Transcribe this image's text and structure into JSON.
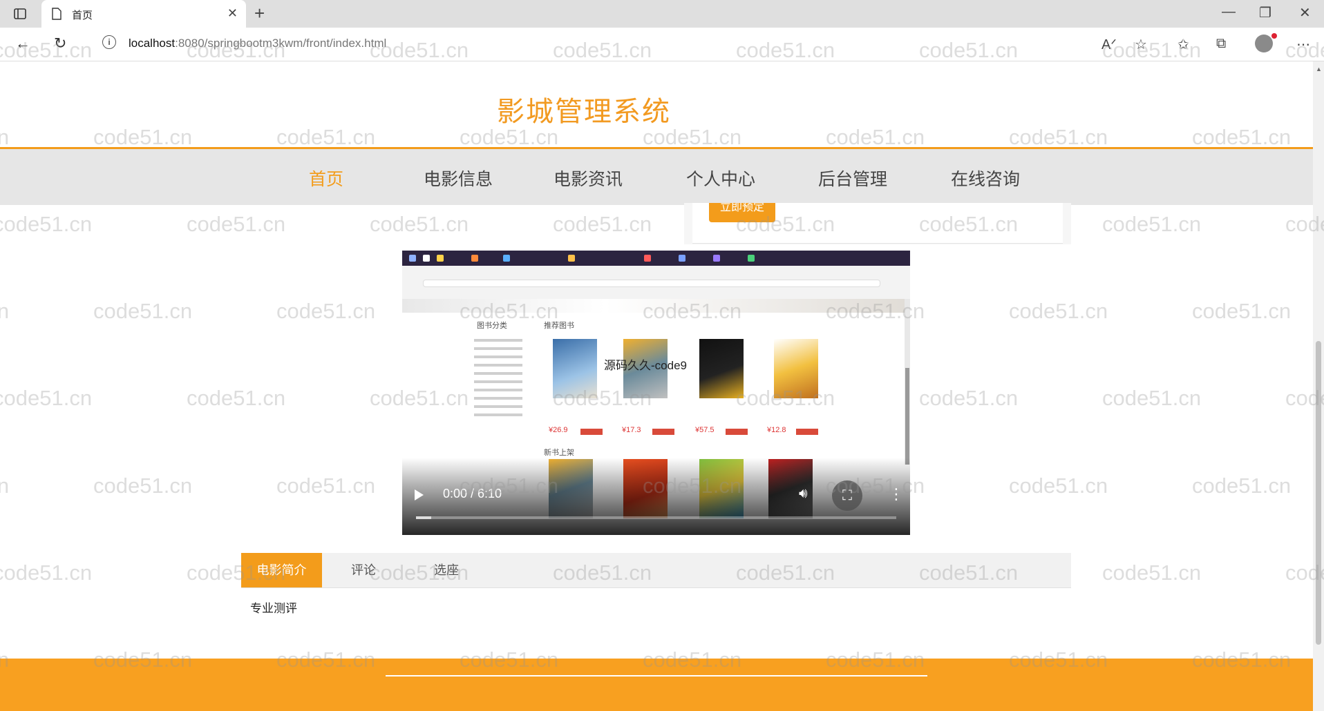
{
  "browser": {
    "tab_title": "首页",
    "url_host": "localhost",
    "url_path": ":8080/springbootm3kwm/front/index.html"
  },
  "site": {
    "title": "影城管理系统",
    "nav": [
      "首页",
      "电影信息",
      "电影资讯",
      "个人中心",
      "后台管理",
      "在线咨询"
    ],
    "active_nav": "首页"
  },
  "partial_button_label": "立即预定",
  "video": {
    "time": "0:00 / 6:10",
    "progress": 0.0,
    "frame": {
      "category_heading": "图书分类",
      "recommended_heading": "推荐图书",
      "new_heading": "新书上架",
      "overlay_text": "源码久久-code9",
      "prices": [
        "¥26.9",
        "¥17.3",
        "¥57.5",
        "¥12.8"
      ]
    }
  },
  "tabs": [
    "电影简介",
    "评论",
    "选座"
  ],
  "active_tab": "电影简介",
  "tab_content": "专业测评",
  "watermark": "code51.cn",
  "colors": {
    "accent": "#f39c1b",
    "footer": "#f8a020"
  }
}
